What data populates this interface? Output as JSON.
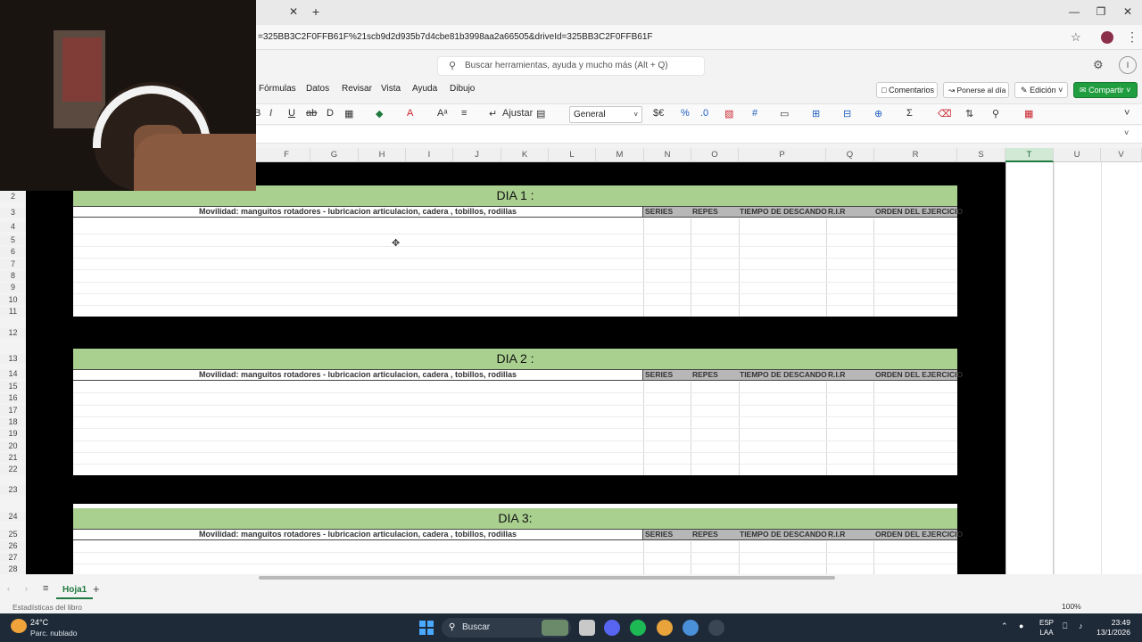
{
  "browser": {
    "url": "=325BB3C2F0FFB61F%21scb9d2d935b7d4cbe81b3998aa2a66505&driveId=325BB3C2F0FFB61F",
    "tab_close": "✕",
    "tab_new": "+"
  },
  "app": {
    "search_placeholder": "Buscar herramientas, ayuda y mucho más (Alt + Q)",
    "profile_initial": "I"
  },
  "menu": {
    "items": [
      "Fórmulas",
      "Datos",
      "Revisar",
      "Vista",
      "Ayuda",
      "Dibujo"
    ],
    "comentarios": "Comentarios",
    "ponerse": "Ponerse al día",
    "edicion": "Edición",
    "compartir": "Compartir"
  },
  "toolbar": {
    "ajustar": "Ajustar",
    "format": "General"
  },
  "columns": [
    "F",
    "G",
    "H",
    "I",
    "J",
    "K",
    "L",
    "M",
    "N",
    "O",
    "P",
    "Q",
    "R",
    "S",
    "T",
    "U",
    "V"
  ],
  "rows": [
    "2",
    "3",
    "4",
    "5",
    "6",
    "7",
    "8",
    "9",
    "10",
    "11",
    "12",
    "13",
    "14",
    "15",
    "16",
    "17",
    "18",
    "19",
    "20",
    "21",
    "22",
    "23",
    "24",
    "25",
    "26",
    "27",
    "28"
  ],
  "blocks": [
    {
      "title": "DIA 1 :",
      "subtitle": "Movilidad: manguitos rotadores - lubricacion articulacion, cadera , tobillos, rodillas",
      "headers": [
        "SERIES",
        "REPES",
        "TIEMPO DE DESCANDO",
        "R.I.R",
        "ORDEN DEL EJERCICIO"
      ]
    },
    {
      "title": "DIA 2 :",
      "subtitle": "Movilidad: manguitos rotadores - lubricacion articulacion, cadera , tobillos, rodillas",
      "headers": [
        "SERIES",
        "REPES",
        "TIEMPO DE DESCANDO",
        "R.I.R",
        "ORDEN DEL EJERCICIO"
      ]
    },
    {
      "title": "DIA 3:",
      "subtitle": "Movilidad: manguitos rotadores - lubricacion articulacion, cadera , tobillos, rodillas",
      "headers": [
        "SERIES",
        "REPES",
        "TIEMPO DE DESCANDO",
        "R.I.R",
        "ORDEN DEL EJERCICIO"
      ]
    }
  ],
  "sheet": {
    "tab_name": "Hoja1",
    "add": "+",
    "status": "Estadísticas del libro",
    "zoom": "100%"
  },
  "taskbar": {
    "temp": "24°C",
    "weather": "Parc. nublado",
    "search": "Buscar",
    "lang_top": "ESP",
    "lang_bottom": "LAA",
    "time": "23:49",
    "date": "13/1/2026"
  },
  "colors": {
    "accent_green": "#1f9d3f",
    "dia_band": "#a9d08e",
    "header_gray": "#b7b7b7"
  }
}
